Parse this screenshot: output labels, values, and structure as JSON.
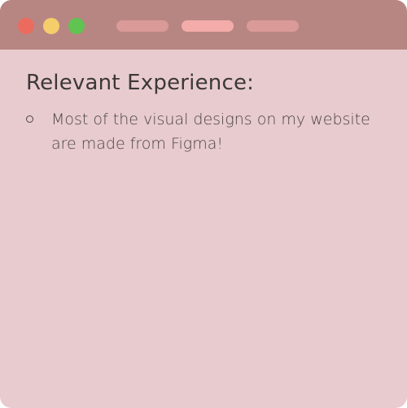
{
  "window": {
    "controls": [
      "close",
      "minimize",
      "maximize"
    ],
    "tab_count": 3,
    "active_tab": 2,
    "colors": {
      "background": "#e8cbce",
      "titlebar": "#b88682",
      "close": "#ec6b5f",
      "minimize": "#f6cd6b",
      "maximize": "#5fc451",
      "tab": "#d99a98",
      "tab_active": "#f3acaa"
    }
  },
  "main": {
    "heading": "Relevant Experience:",
    "bullets": [
      {
        "marker": "circle-bullet-icon",
        "text": "Most of the visual designs on my website are made from Figma!"
      }
    ]
  }
}
